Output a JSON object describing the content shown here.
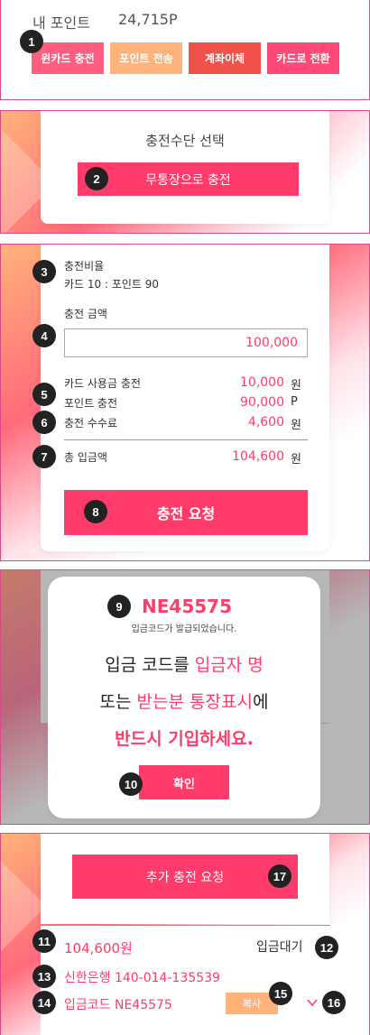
{
  "header": {
    "points_label": "내 포인트",
    "points_value": "24,715P",
    "buttons": [
      "윈카드 충전",
      "포인트 전송",
      "계좌이체",
      "카드로 전환"
    ]
  },
  "method": {
    "title": "충전수단 선택",
    "button": "무통장으로 충전"
  },
  "charge": {
    "ratio_label": "충전비율",
    "ratio_value": "카드 10 : 포인트 90",
    "amount_label": "충전 금액",
    "amount_value": "100,000",
    "rows": [
      {
        "label": "카드 사용금 충전",
        "value": "10,000",
        "unit": "원"
      },
      {
        "label": "포인트 충전",
        "value": "90,000",
        "unit": "P"
      },
      {
        "label": "충전 수수료",
        "value": "4,600",
        "unit": "원"
      }
    ],
    "total_label": "총 입금액",
    "total_value": "104,600",
    "total_unit": "원",
    "submit": "충전 요청"
  },
  "modal": {
    "code": "NE45575",
    "issued": "입금코드가 발급되었습니다.",
    "line1_a": "입금 코드를 ",
    "line1_b": "입금자 명",
    "line2_a": "또는 ",
    "line2_b": "받는분 통장표시",
    "line2_c": "에",
    "line3": "반드시 기입하세요.",
    "confirm": "확인"
  },
  "request": {
    "add_button": "추가 충전 요청",
    "amount": "104,600원",
    "status": "입금대기",
    "bank": "신한은행 140-014-135539",
    "code_line": "입금코드 NE45575",
    "copy": "복사"
  },
  "badges": [
    "1",
    "2",
    "3",
    "4",
    "5",
    "6",
    "7",
    "8",
    "9",
    "10",
    "11",
    "12",
    "13",
    "14",
    "15",
    "16",
    "17"
  ],
  "colors": {
    "accent": "#ff3b6b",
    "orange": "#ffb27a",
    "red": "#f0524a"
  }
}
